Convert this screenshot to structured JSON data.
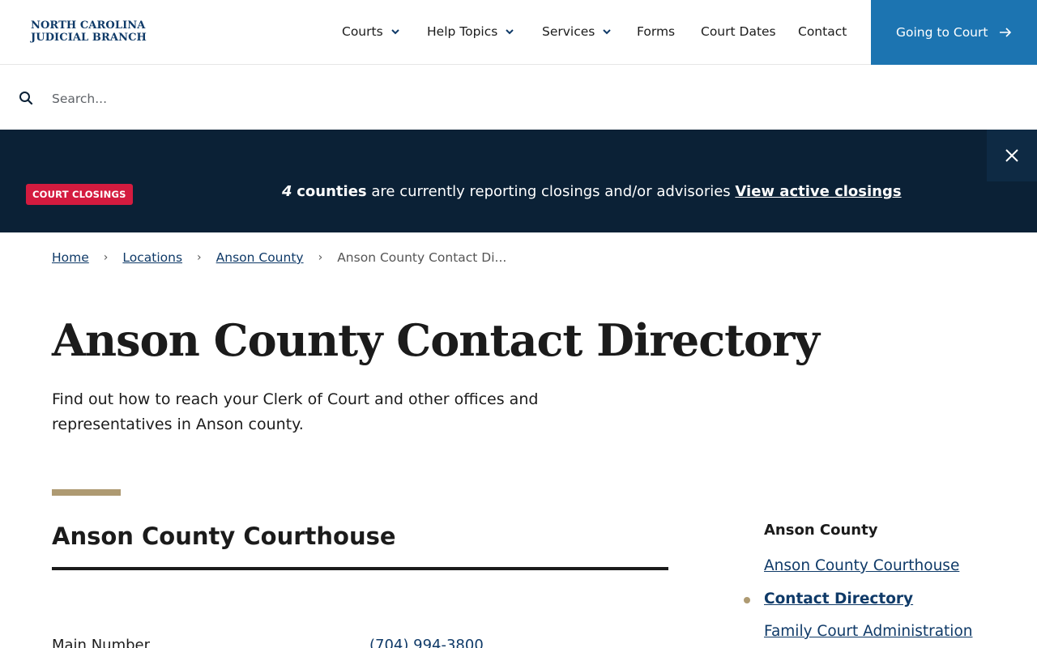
{
  "header": {
    "logo_line1": "NORTH CAROLINA",
    "logo_line2": "JUDICIAL BRANCH",
    "nav": [
      {
        "label": "Courts",
        "has_dropdown": true
      },
      {
        "label": "Help Topics",
        "has_dropdown": true
      },
      {
        "label": "Services",
        "has_dropdown": true
      },
      {
        "label": "Forms",
        "has_dropdown": false
      },
      {
        "label": "Court Dates",
        "has_dropdown": false
      },
      {
        "label": "Contact",
        "has_dropdown": false
      }
    ],
    "cta_label": "Going to Court",
    "cta_color": "#1c74b1"
  },
  "search": {
    "placeholder": "Search..."
  },
  "alert": {
    "badge": "COURT CLOSINGS",
    "count": "4",
    "counties_word": "counties",
    "message": " are currently reporting closings and/or advisories ",
    "link": "View active closings",
    "bg_color": "#0b2136",
    "badge_color": "#d41b3f"
  },
  "breadcrumb": {
    "items": [
      "Home",
      "Locations",
      "Anson County"
    ],
    "current": "Anson County Contact Di..."
  },
  "page": {
    "title": "Anson County Contact Directory",
    "intro": "Find out how to reach your Clerk of Court and other offices and representatives in Anson county."
  },
  "section": {
    "title": "Anson County Courthouse",
    "rows": [
      {
        "label": "Main Number",
        "value": "(704) 994-3800"
      }
    ]
  },
  "sidenav": {
    "heading": "Anson County",
    "items": [
      {
        "label": "Anson County Courthouse",
        "active": false
      },
      {
        "label": "Contact Directory",
        "active": true
      },
      {
        "label": "Family Court Administration",
        "active": false
      }
    ]
  },
  "colors": {
    "link": "#0f3a68",
    "accent": "#ae9a72"
  }
}
